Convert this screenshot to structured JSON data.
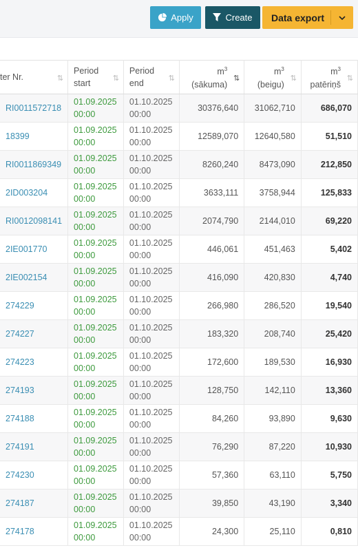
{
  "toolbar": {
    "apply_label": "Apply",
    "create_label": "Create",
    "export_label": "Data export",
    "accent_apply": "#3aa3c8",
    "accent_create": "#1a5766",
    "accent_export": "#f5b533"
  },
  "table": {
    "headers": {
      "meter": "ter Nr.",
      "period_start_1": "Period",
      "period_start_2": "start",
      "period_end_1": "Period",
      "period_end_2": "end",
      "m3_start_unit": "m",
      "m3_start_sup": "3",
      "m3_start_label": "(sākuma)",
      "m3_end_unit": "m",
      "m3_end_sup": "3",
      "m3_end_label": "(beigu)",
      "m3_cons_unit": "m",
      "m3_cons_sup": "3",
      "m3_cons_label": "patēriņš"
    },
    "rows": [
      {
        "meter": "RI0011572718",
        "start_date": "01.09.2025",
        "start_time": "00:00",
        "end_date": "01.10.2025",
        "end_time": "00:00",
        "m3_start": "30376,640",
        "m3_end": "31062,710",
        "m3_cons": "686,070"
      },
      {
        "meter": "18399",
        "start_date": "01.09.2025",
        "start_time": "00:00",
        "end_date": "01.10.2025",
        "end_time": "00:00",
        "m3_start": "12589,070",
        "m3_end": "12640,580",
        "m3_cons": "51,510"
      },
      {
        "meter": "RI0011869349",
        "start_date": "01.09.2025",
        "start_time": "00:00",
        "end_date": "01.10.2025",
        "end_time": "00:00",
        "m3_start": "8260,240",
        "m3_end": "8473,090",
        "m3_cons": "212,850"
      },
      {
        "meter": "2ID003204",
        "start_date": "01.09.2025",
        "start_time": "00:00",
        "end_date": "01.10.2025",
        "end_time": "00:00",
        "m3_start": "3633,111",
        "m3_end": "3758,944",
        "m3_cons": "125,833"
      },
      {
        "meter": "RI0012098141",
        "start_date": "01.09.2025",
        "start_time": "00:00",
        "end_date": "01.10.2025",
        "end_time": "00:00",
        "m3_start": "2074,790",
        "m3_end": "2144,010",
        "m3_cons": "69,220"
      },
      {
        "meter": "2IE001770",
        "start_date": "01.09.2025",
        "start_time": "00:00",
        "end_date": "01.10.2025",
        "end_time": "00:00",
        "m3_start": "446,061",
        "m3_end": "451,463",
        "m3_cons": "5,402"
      },
      {
        "meter": "2IE002154",
        "start_date": "01.09.2025",
        "start_time": "00:00",
        "end_date": "01.10.2025",
        "end_time": "00:00",
        "m3_start": "416,090",
        "m3_end": "420,830",
        "m3_cons": "4,740"
      },
      {
        "meter": "274229",
        "start_date": "01.09.2025",
        "start_time": "00:00",
        "end_date": "01.10.2025",
        "end_time": "00:00",
        "m3_start": "266,980",
        "m3_end": "286,520",
        "m3_cons": "19,540"
      },
      {
        "meter": "274227",
        "start_date": "01.09.2025",
        "start_time": "00:00",
        "end_date": "01.10.2025",
        "end_time": "00:00",
        "m3_start": "183,320",
        "m3_end": "208,740",
        "m3_cons": "25,420"
      },
      {
        "meter": "274223",
        "start_date": "01.09.2025",
        "start_time": "00:00",
        "end_date": "01.10.2025",
        "end_time": "00:00",
        "m3_start": "172,600",
        "m3_end": "189,530",
        "m3_cons": "16,930"
      },
      {
        "meter": "274193",
        "start_date": "01.09.2025",
        "start_time": "00:00",
        "end_date": "01.10.2025",
        "end_time": "00:00",
        "m3_start": "128,750",
        "m3_end": "142,110",
        "m3_cons": "13,360"
      },
      {
        "meter": "274188",
        "start_date": "01.09.2025",
        "start_time": "00:00",
        "end_date": "01.10.2025",
        "end_time": "00:00",
        "m3_start": "84,260",
        "m3_end": "93,890",
        "m3_cons": "9,630"
      },
      {
        "meter": "274191",
        "start_date": "01.09.2025",
        "start_time": "00:00",
        "end_date": "01.10.2025",
        "end_time": "00:00",
        "m3_start": "76,290",
        "m3_end": "87,220",
        "m3_cons": "10,930"
      },
      {
        "meter": "274230",
        "start_date": "01.09.2025",
        "start_time": "00:00",
        "end_date": "01.10.2025",
        "end_time": "00:00",
        "m3_start": "57,360",
        "m3_end": "63,110",
        "m3_cons": "5,750"
      },
      {
        "meter": "274187",
        "start_date": "01.09.2025",
        "start_time": "00:00",
        "end_date": "01.10.2025",
        "end_time": "00:00",
        "m3_start": "39,850",
        "m3_end": "43,190",
        "m3_cons": "3,340"
      },
      {
        "meter": "274178",
        "start_date": "01.09.2025",
        "start_time": "00:00",
        "end_date": "01.10.2025",
        "end_time": "00:00",
        "m3_start": "24,300",
        "m3_end": "25,110",
        "m3_cons": "0,810"
      }
    ]
  }
}
